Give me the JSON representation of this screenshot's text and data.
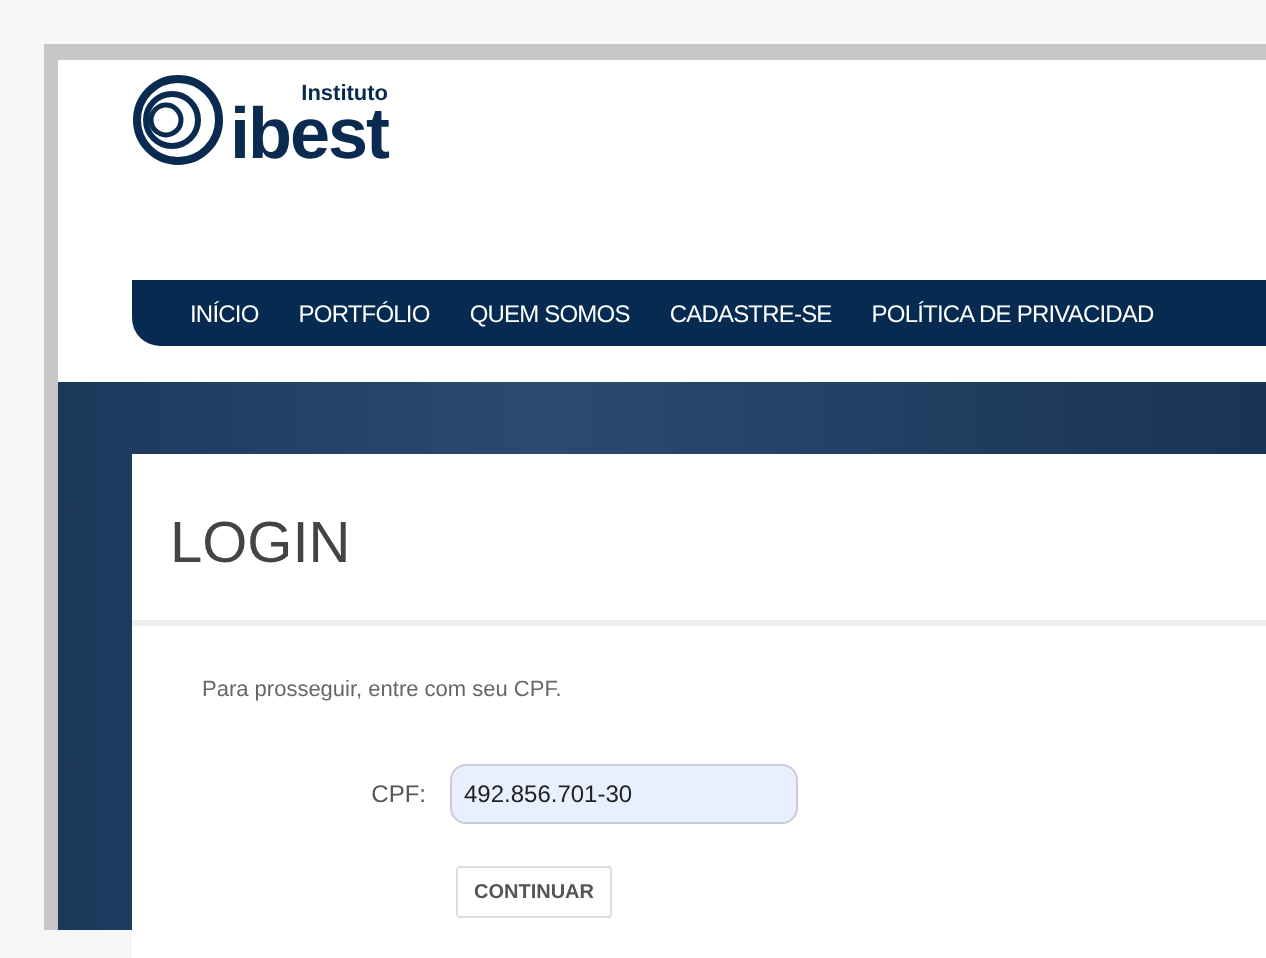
{
  "logo": {
    "small": "Instituto",
    "name": "ibest"
  },
  "nav": {
    "items": [
      {
        "label": "INÍCIO"
      },
      {
        "label": "PORTFÓLIO"
      },
      {
        "label": "QUEM SOMOS"
      },
      {
        "label": "CADASTRE-SE"
      },
      {
        "label": "POLÍTICA DE PRIVACIDAD"
      }
    ]
  },
  "login": {
    "title": "LOGIN",
    "instructions": "Para prosseguir, entre com seu CPF.",
    "field_label": "CPF:",
    "field_value": "492.856.701-30",
    "button": "CONTINUAR"
  }
}
